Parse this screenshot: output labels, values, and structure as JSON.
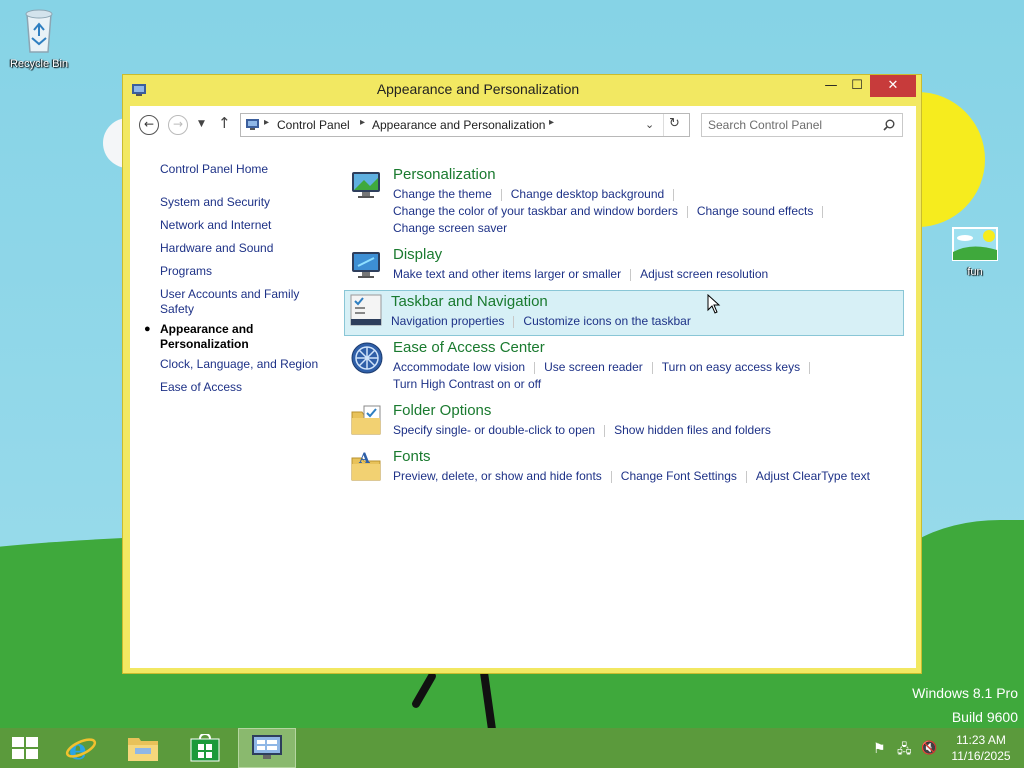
{
  "desktop": {
    "icons": [
      {
        "label": "Recycle Bin",
        "icon": "recycle-bin-icon"
      },
      {
        "label": "fun",
        "icon": "image-file-icon"
      }
    ],
    "watermark": {
      "line1": "Windows 8.1 Pro",
      "line2": "Build 9600"
    }
  },
  "window": {
    "title": "Appearance and Personalization",
    "controls": {
      "minimize": "—",
      "maximize": "☐",
      "close": "✕"
    },
    "address": {
      "crumbs": [
        "Control Panel",
        "Appearance and Personalization"
      ]
    },
    "search": {
      "placeholder": "Search Control Panel"
    },
    "left_nav": {
      "home": "Control Panel Home",
      "items": [
        "System and Security",
        "Network and Internet",
        "Hardware and Sound",
        "Programs",
        "User Accounts and Family Safety",
        "Appearance and Personalization",
        "Clock, Language, and Region",
        "Ease of Access"
      ],
      "current": "Appearance and Personalization"
    },
    "categories": [
      {
        "title": "Personalization",
        "icon": "personalization-monitor-icon",
        "links": [
          "Change the theme",
          "Change desktop background",
          "Change the color of your taskbar and window borders",
          "Change sound effects",
          "Change screen saver"
        ]
      },
      {
        "title": "Display",
        "icon": "display-monitor-icon",
        "links": [
          "Make text and other items larger or smaller",
          "Adjust screen resolution"
        ]
      },
      {
        "title": "Taskbar and Navigation",
        "icon": "taskbar-icon",
        "links": [
          "Navigation properties",
          "Customize icons on the taskbar"
        ]
      },
      {
        "title": "Ease of Access Center",
        "icon": "ease-of-access-icon",
        "links": [
          "Accommodate low vision",
          "Use screen reader",
          "Turn on easy access keys",
          "Turn High Contrast on or off"
        ]
      },
      {
        "title": "Folder Options",
        "icon": "folder-options-icon",
        "links": [
          "Specify single- or double-click to open",
          "Show hidden files and folders"
        ]
      },
      {
        "title": "Fonts",
        "icon": "fonts-folder-icon",
        "links": [
          "Preview, delete, or show and hide fonts",
          "Change Font Settings",
          "Adjust ClearType text"
        ]
      }
    ]
  },
  "taskbar": {
    "buttons": [
      "start-icon",
      "internet-explorer-icon",
      "file-explorer-icon",
      "store-icon",
      "control-panel-icon"
    ],
    "clock": {
      "time": "11:23 AM",
      "date": "11/16/2025"
    }
  },
  "colors": {
    "window_frame": "#f2e862",
    "taskbar": "#5b9a3c",
    "link": "#1e3287",
    "category_title": "#1a7a2f",
    "close_button": "#c73b3b"
  }
}
